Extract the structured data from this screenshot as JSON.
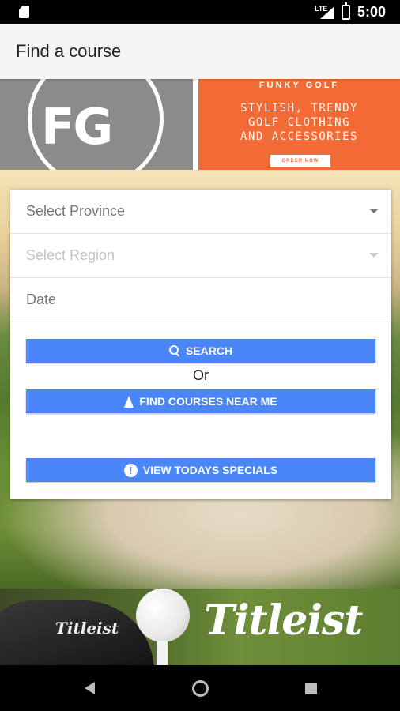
{
  "status_bar": {
    "network": "LTE",
    "time": "5:00"
  },
  "app_bar": {
    "title": "Find a course"
  },
  "ad_top": {
    "logo_text": "FG",
    "brand": "FUNKY GOLF",
    "tagline_1": "STYLISH, TRENDY",
    "tagline_2": "GOLF CLOTHING",
    "tagline_3": "AND ACCESSORIES",
    "cta": "ORDER NOW",
    "accent_color": "#f26a36"
  },
  "form": {
    "province_placeholder": "Select Province",
    "region_placeholder": "Select Region",
    "date_placeholder": "Date",
    "search_label": "SEARCH",
    "or_label": "Or",
    "near_me_label": "FIND COURSES NEAR ME",
    "specials_label": "VIEW TODAYS SPECIALS",
    "button_color": "#4a86f7"
  },
  "ad_bottom": {
    "club_text": "Titleist",
    "brand": "Titleist"
  }
}
